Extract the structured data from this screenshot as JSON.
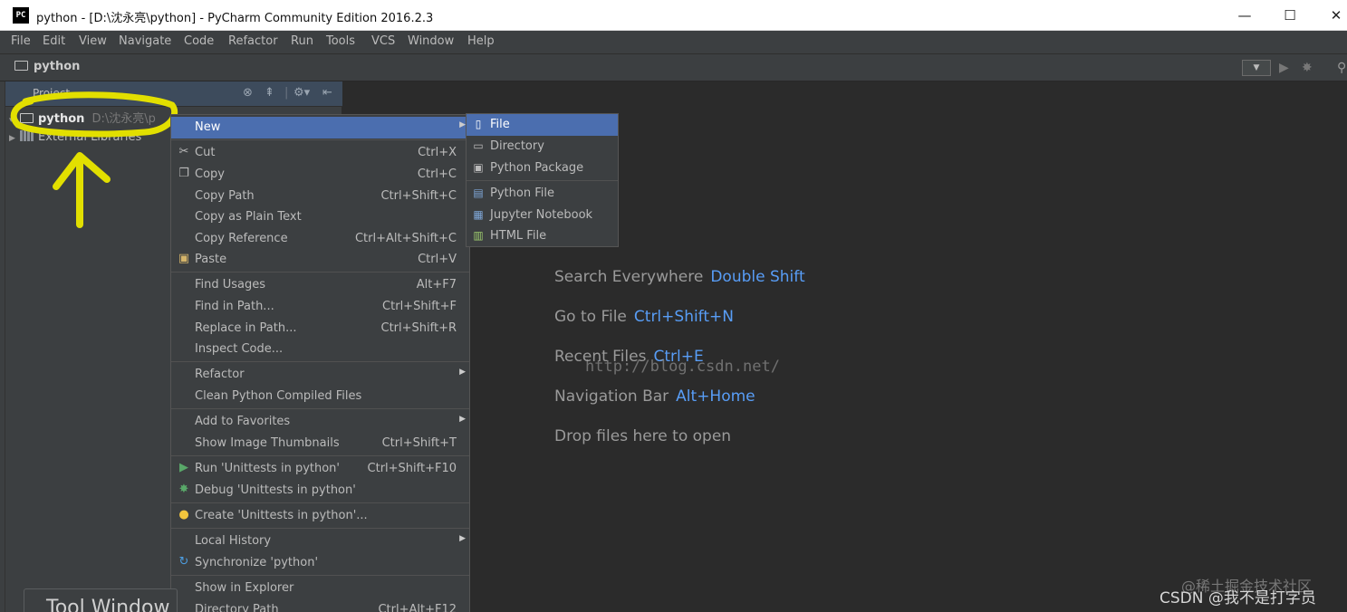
{
  "window": {
    "title": "python - [D:\\沈永亮\\python] - PyCharm Community Edition 2016.2.3",
    "logo_text": "PC",
    "minimize": "—",
    "maximize": "☐",
    "close": "✕"
  },
  "menubar": [
    "File",
    "Edit",
    "View",
    "Navigate",
    "Code",
    "Refactor",
    "Run",
    "Tools",
    "VCS",
    "Window",
    "Help"
  ],
  "navbar": {
    "breadcrumb": "python"
  },
  "project_panel": {
    "title": "Project",
    "tree": [
      {
        "label": "python",
        "path": "D:\\沈永亮\\p"
      },
      {
        "label": "External Libraries"
      }
    ]
  },
  "context_menu": {
    "items": [
      {
        "label": "New",
        "shortcut": "",
        "submenu": true,
        "selected": true
      },
      {
        "label": "Cut",
        "shortcut": "Ctrl+X",
        "icon": "scissors-icon"
      },
      {
        "label": "Copy",
        "shortcut": "Ctrl+C",
        "icon": "copy-icon"
      },
      {
        "label": "Copy Path",
        "shortcut": "Ctrl+Shift+C"
      },
      {
        "label": "Copy as Plain Text",
        "shortcut": ""
      },
      {
        "label": "Copy Reference",
        "shortcut": "Ctrl+Alt+Shift+C"
      },
      {
        "label": "Paste",
        "shortcut": "Ctrl+V",
        "icon": "paste-icon"
      },
      {
        "label": "Find Usages",
        "shortcut": "Alt+F7"
      },
      {
        "label": "Find in Path...",
        "shortcut": "Ctrl+Shift+F"
      },
      {
        "label": "Replace in Path...",
        "shortcut": "Ctrl+Shift+R"
      },
      {
        "label": "Inspect Code...",
        "shortcut": ""
      },
      {
        "label": "Refactor",
        "shortcut": "",
        "submenu": true
      },
      {
        "label": "Clean Python Compiled Files",
        "shortcut": ""
      },
      {
        "label": "Add to Favorites",
        "shortcut": "",
        "submenu": true
      },
      {
        "label": "Show Image Thumbnails",
        "shortcut": "Ctrl+Shift+T"
      },
      {
        "label": "Run 'Unittests in python'",
        "shortcut": "Ctrl+Shift+F10",
        "icon": "run-icon"
      },
      {
        "label": "Debug 'Unittests in python'",
        "shortcut": "",
        "icon": "debug-icon"
      },
      {
        "label": "Create 'Unittests in python'...",
        "shortcut": "",
        "icon": "python-icon"
      },
      {
        "label": "Local History",
        "shortcut": "",
        "submenu": true
      },
      {
        "label": "Synchronize 'python'",
        "shortcut": "",
        "icon": "sync-icon"
      },
      {
        "label": "Show in Explorer",
        "shortcut": ""
      },
      {
        "label": "Directory Path",
        "shortcut": "Ctrl+Alt+F12"
      }
    ]
  },
  "new_submenu": {
    "items": [
      {
        "label": "File",
        "selected": true,
        "icon": "file-icon"
      },
      {
        "label": "Directory",
        "icon": "folder-icon"
      },
      {
        "label": "Python Package",
        "icon": "package-icon"
      },
      {
        "label": "Python File",
        "icon": "python-file-icon"
      },
      {
        "label": "Jupyter Notebook",
        "icon": "notebook-icon"
      },
      {
        "label": "HTML File",
        "icon": "html-file-icon"
      }
    ]
  },
  "editor_hints": [
    {
      "text": "Search Everywhere",
      "key": "Double Shift"
    },
    {
      "text": "Go to File",
      "key": "Ctrl+Shift+N"
    },
    {
      "text": "Recent Files",
      "key": "Ctrl+E"
    },
    {
      "text": "Navigation Bar",
      "key": "Alt+Home"
    },
    {
      "text": "Drop files here to open",
      "key": ""
    }
  ],
  "tool_window_hint": "Tool Window",
  "watermarks": {
    "url": "http://blog.csdn.net/",
    "juejin": "@稀土掘金技术社区",
    "csdn": "CSDN @我不是打字员"
  },
  "colors": {
    "accent": "#4b6eaf",
    "key_blue": "#589df6",
    "annotation_yellow": "#e2df00",
    "bg_dark": "#2b2b2b",
    "panel": "#3c3f41"
  }
}
